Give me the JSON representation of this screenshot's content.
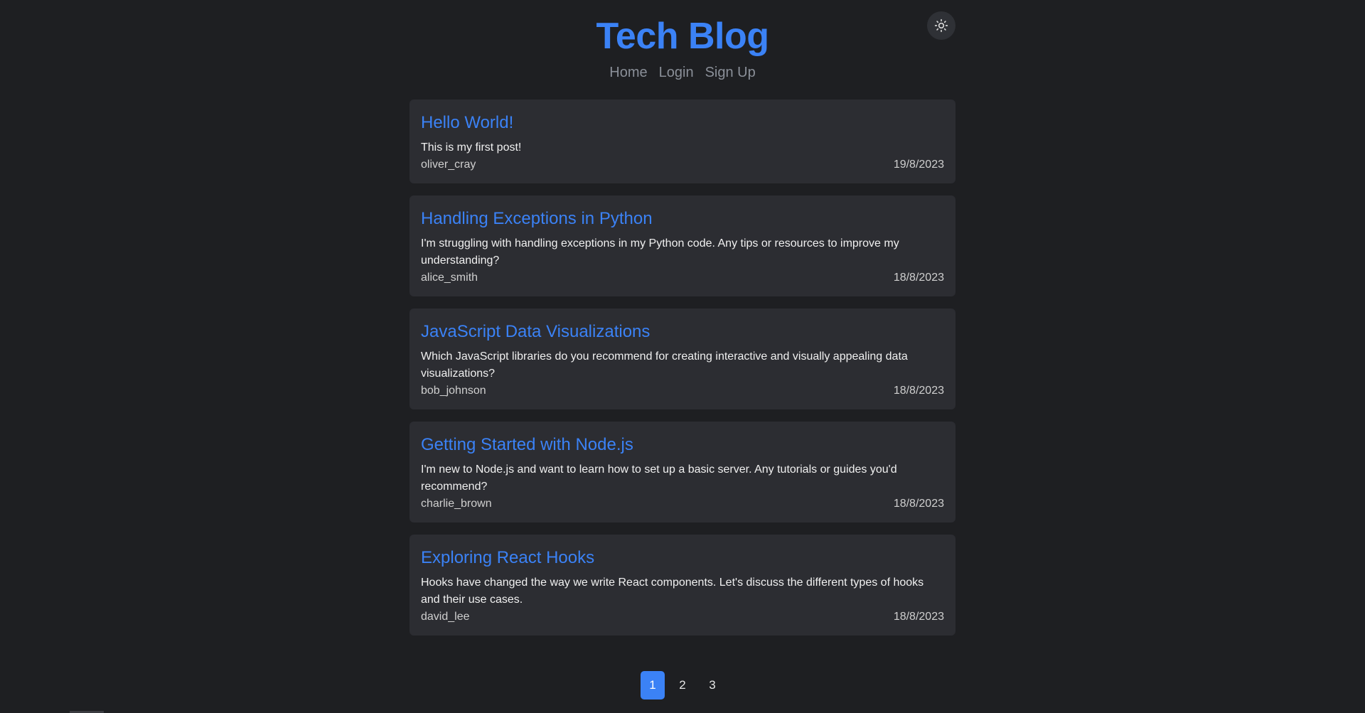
{
  "header": {
    "title": "Tech Blog",
    "theme_toggle_icon": "sun-icon"
  },
  "nav": {
    "items": [
      {
        "label": "Home"
      },
      {
        "label": "Login"
      },
      {
        "label": "Sign Up"
      }
    ]
  },
  "posts": [
    {
      "title": "Hello World!",
      "body": "This is my first post!",
      "author": "oliver_cray",
      "date": "19/8/2023"
    },
    {
      "title": "Handling Exceptions in Python",
      "body": "I'm struggling with handling exceptions in my Python code. Any tips or resources to improve my understanding?",
      "author": "alice_smith",
      "date": "18/8/2023"
    },
    {
      "title": "JavaScript Data Visualizations",
      "body": "Which JavaScript libraries do you recommend for creating interactive and visually appealing data visualizations?",
      "author": "bob_johnson",
      "date": "18/8/2023"
    },
    {
      "title": "Getting Started with Node.js",
      "body": "I'm new to Node.js and want to learn how to set up a basic server. Any tutorials or guides you'd recommend?",
      "author": "charlie_brown",
      "date": "18/8/2023"
    },
    {
      "title": "Exploring React Hooks",
      "body": "Hooks have changed the way we write React components. Let's discuss the different types of hooks and their use cases.",
      "author": "david_lee",
      "date": "18/8/2023"
    }
  ],
  "pagination": {
    "pages": [
      "1",
      "2",
      "3"
    ],
    "current": "1"
  },
  "colors": {
    "background": "#1e1f22",
    "card": "#2c2d32",
    "accent": "#3b82f6",
    "nav_text": "#8a8f98"
  }
}
